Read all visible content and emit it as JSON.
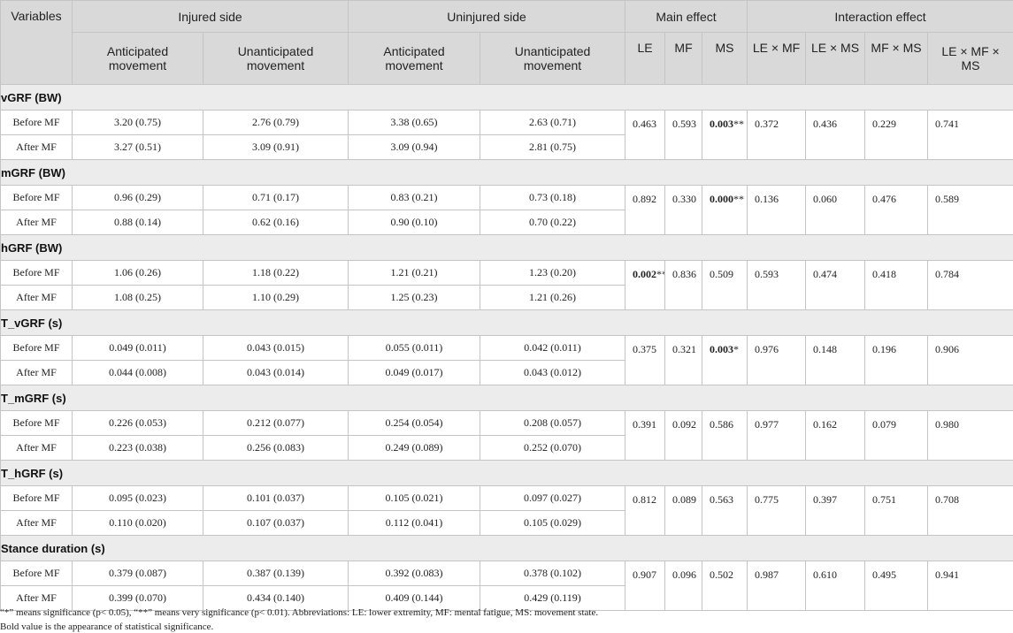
{
  "headers": {
    "variables": "Variables",
    "injured_side": "Injured side",
    "uninjured_side": "Uninjured side",
    "main_effect": "Main effect",
    "interaction_effect": "Interaction effect",
    "sub": [
      "Anticipated movement",
      "Unanticipated movement",
      "Anticipated movement",
      "Unanticipated movement",
      "LE",
      "MF",
      "MS",
      "LE × MF",
      "LE × MS",
      "MF × MS",
      "LE × MF × MS"
    ]
  },
  "groups": [
    {
      "name": "vGRF (BW)",
      "rows": [
        {
          "label": "Before MF",
          "values": [
            "3.20 (0.75)",
            "2.76 (0.79)",
            "3.38 (0.65)",
            "2.63 (0.71)"
          ]
        },
        {
          "label": "After MF",
          "values": [
            "3.27 (0.51)",
            "3.09 (0.91)",
            "3.09 (0.94)",
            "2.81 (0.75)"
          ]
        }
      ],
      "main": {
        "LE": "0.463",
        "MF": "0.593",
        "MS": "0.003",
        "MS_mark": "**"
      },
      "interaction": {
        "LExMF": "0.372",
        "LExMS": "0.436",
        "MFxMS": "0.229",
        "LExMFxMS": "0.741"
      }
    },
    {
      "name": "mGRF (BW)",
      "rows": [
        {
          "label": "Before MF",
          "values": [
            "0.96 (0.29)",
            "0.71 (0.17)",
            "0.83 (0.21)",
            "0.73 (0.18)"
          ]
        },
        {
          "label": "After MF",
          "values": [
            "0.88 (0.14)",
            "0.62 (0.16)",
            "0.90 (0.10)",
            "0.70 (0.22)"
          ]
        }
      ],
      "main": {
        "LE": "0.892",
        "MF": "0.330",
        "MS": "0.000",
        "MS_mark": "**"
      },
      "interaction": {
        "LExMF": "0.136",
        "LExMS": "0.060",
        "MFxMS": "0.476",
        "LExMFxMS": "0.589"
      }
    },
    {
      "name": "hGRF (BW)",
      "rows": [
        {
          "label": "Before MF",
          "values": [
            "1.06 (0.26)",
            "1.18 (0.22)",
            "1.21 (0.21)",
            "1.23 (0.20)"
          ]
        },
        {
          "label": "After MF",
          "values": [
            "1.08 (0.25)",
            "1.10 (0.29)",
            "1.25 (0.23)",
            "1.21 (0.26)"
          ]
        }
      ],
      "main": {
        "LE": "0.002",
        "LE_mark": "**",
        "MF": "0.836",
        "MS": "0.509"
      },
      "interaction": {
        "LExMF": "0.593",
        "LExMS": "0.474",
        "MFxMS": "0.418",
        "LExMFxMS": "0.784"
      }
    },
    {
      "name": "T_vGRF (s)",
      "rows": [
        {
          "label": "Before MF",
          "values": [
            "0.049 (0.011)",
            "0.043 (0.015)",
            "0.055 (0.011)",
            "0.042 (0.011)"
          ]
        },
        {
          "label": "After MF",
          "values": [
            "0.044 (0.008)",
            "0.043 (0.014)",
            "0.049 (0.017)",
            "0.043 (0.012)"
          ]
        }
      ],
      "main": {
        "LE": "0.375",
        "MF": "0.321",
        "MS": "0.003",
        "MS_mark": "*"
      },
      "interaction": {
        "LExMF": "0.976",
        "LExMS": "0.148",
        "MFxMS": "0.196",
        "LExMFxMS": "0.906"
      }
    },
    {
      "name": "T_mGRF (s)",
      "rows": [
        {
          "label": "Before MF",
          "values": [
            "0.226 (0.053)",
            "0.212 (0.077)",
            "0.254 (0.054)",
            "0.208 (0.057)"
          ]
        },
        {
          "label": "After MF",
          "values": [
            "0.223 (0.038)",
            "0.256 (0.083)",
            "0.249 (0.089)",
            "0.252 (0.070)"
          ]
        }
      ],
      "main": {
        "LE": "0.391",
        "MF": "0.092",
        "MS": "0.586"
      },
      "interaction": {
        "LExMF": "0.977",
        "LExMS": "0.162",
        "MFxMS": "0.079",
        "LExMFxMS": "0.980"
      }
    },
    {
      "name": "T_hGRF (s)",
      "rows": [
        {
          "label": "Before MF",
          "values": [
            "0.095 (0.023)",
            "0.101 (0.037)",
            "0.105 (0.021)",
            "0.097 (0.027)"
          ]
        },
        {
          "label": "After MF",
          "values": [
            "0.110 (0.020)",
            "0.107 (0.037)",
            "0.112 (0.041)",
            "0.105 (0.029)"
          ]
        }
      ],
      "main": {
        "LE": "0.812",
        "MF": "0.089",
        "MS": "0.563"
      },
      "interaction": {
        "LExMF": "0.775",
        "LExMS": "0.397",
        "MFxMS": "0.751",
        "LExMFxMS": "0.708"
      }
    },
    {
      "name": "Stance duration (s)",
      "rows": [
        {
          "label": "Before MF",
          "values": [
            "0.379 (0.087)",
            "0.387 (0.139)",
            "0.392 (0.083)",
            "0.378 (0.102)"
          ]
        },
        {
          "label": "After MF",
          "values": [
            "0.399 (0.070)",
            "0.434 (0.140)",
            "0.409 (0.144)",
            "0.429 (0.119)"
          ]
        }
      ],
      "main": {
        "LE": "0.907",
        "MF": "0.096",
        "MS": "0.502"
      },
      "interaction": {
        "LExMF": "0.987",
        "LExMS": "0.610",
        "MFxMS": "0.495",
        "LExMFxMS": "0.941"
      }
    }
  ],
  "footnote": {
    "line1": "“*” means significance (p< 0.05), “**” means very significance (p< 0.01). Abbreviations: LE: lower extremity, MF: mental fatigue, MS: movement state.",
    "line2": "Bold value is the appearance of statistical significance."
  }
}
